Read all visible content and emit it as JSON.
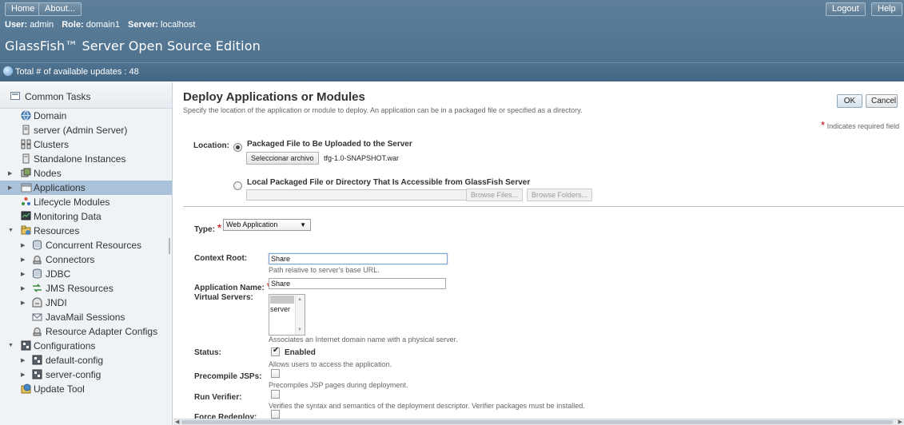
{
  "masthead": {
    "home_label": "Home",
    "about_label": "About...",
    "logout_label": "Logout",
    "help_label": "Help",
    "user_label": "User:",
    "user_value": "admin",
    "role_label": "Role:",
    "role_value": "domain1",
    "server_label": "Server:",
    "server_value": "localhost",
    "brand": "GlassFish™ Server Open Source Edition",
    "updates_text": "Total # of available updates : 48"
  },
  "nav": {
    "header": "Common Tasks",
    "items": [
      {
        "label": "Domain",
        "icon": "domain-icon"
      },
      {
        "label": "server (Admin Server)",
        "icon": "server-icon"
      },
      {
        "label": "Clusters",
        "icon": "clusters-icon"
      },
      {
        "label": "Standalone Instances",
        "icon": "instances-icon"
      },
      {
        "label": "Nodes",
        "icon": "nodes-icon"
      },
      {
        "label": "Applications",
        "icon": "applications-icon"
      },
      {
        "label": "Lifecycle Modules",
        "icon": "lifecycle-icon"
      },
      {
        "label": "Monitoring Data",
        "icon": "monitoring-icon"
      },
      {
        "label": "Resources",
        "icon": "resources-icon"
      },
      {
        "label": "Concurrent Resources",
        "icon": "database-icon"
      },
      {
        "label": "Connectors",
        "icon": "connector-icon"
      },
      {
        "label": "JDBC",
        "icon": "database-icon"
      },
      {
        "label": "JMS Resources",
        "icon": "jms-icon"
      },
      {
        "label": "JNDI",
        "icon": "jndi-icon"
      },
      {
        "label": "JavaMail Sessions",
        "icon": "mail-icon"
      },
      {
        "label": "Resource Adapter Configs",
        "icon": "connector-icon"
      },
      {
        "label": "Configurations",
        "icon": "config-icon"
      },
      {
        "label": "default-config",
        "icon": "config-icon"
      },
      {
        "label": "server-config",
        "icon": "config-icon"
      },
      {
        "label": "Update Tool",
        "icon": "update-tool-icon"
      }
    ]
  },
  "page": {
    "title": "Deploy Applications or Modules",
    "help": "Specify the location of the application or module to deploy. An application can be in a packaged file or specified as a directory.",
    "ok_label": "OK",
    "cancel_label": "Cancel",
    "required_star": "*",
    "required_note": "Indicates required field",
    "location_label": "Location:",
    "option_upload": "Packaged File to Be Uploaded to the Server",
    "choose_file_label": "Seleccionar archivo",
    "chosen_file": "tfg-1.0-SNAPSHOT.war",
    "option_local": "Local Packaged File or Directory That Is Accessible from GlassFish Server",
    "browse_files_label": "Browse Files...",
    "browse_folders_label": "Browse Folders...",
    "type_label": "Type:",
    "type_value": "Web Application",
    "type_arrow": "▼",
    "context_root_label": "Context Root:",
    "context_root_value": "Share",
    "context_root_help": "Path relative to server's base URL.",
    "app_name_label": "Application Name:",
    "app_name_value": "Share",
    "virtual_servers_label": "Virtual Servers:",
    "virtual_servers_options": [
      "server"
    ],
    "virtual_servers_help": "Associates an Internet domain name with a physical server.",
    "status_label": "Status:",
    "status_enabled_label": "Enabled",
    "status_help": "Allows users to access the application.",
    "precompile_label": "Precompile JSPs:",
    "precompile_help": "Precompiles JSP pages during deployment.",
    "run_verifier_label": "Run Verifier:",
    "run_verifier_help": "Verifies the syntax and semantics of the deployment descriptor. Verifier packages must be installed.",
    "force_redeploy_label": "Force Redeploy:"
  }
}
